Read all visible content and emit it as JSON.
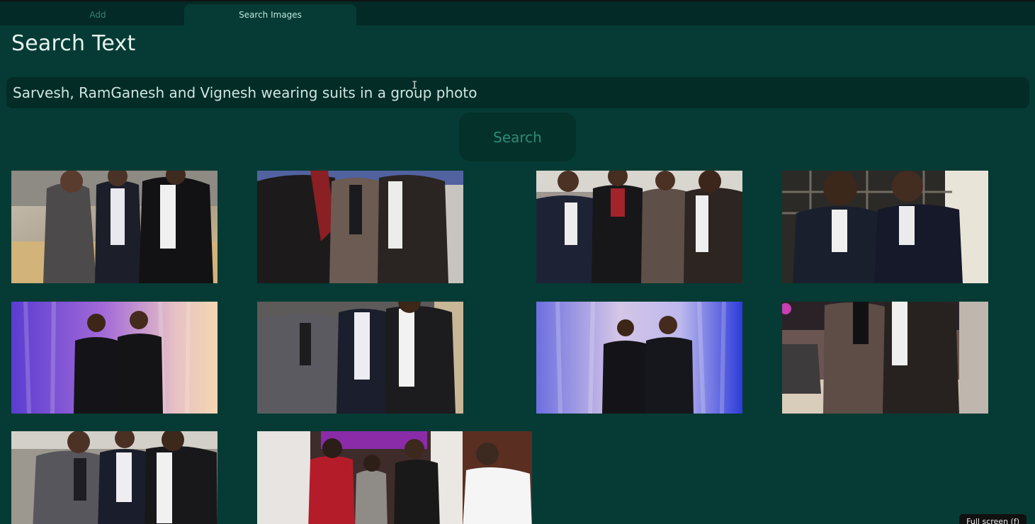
{
  "tabs": [
    {
      "label": "Add",
      "active": false
    },
    {
      "label": "Search Images",
      "active": true
    }
  ],
  "page_title": "Search Text",
  "search": {
    "value": "Sarvesh, RamGanesh and Vignesh wearing suits in a group photo",
    "button_label": "Search"
  },
  "results": [
    {
      "kind": "group-3-suits-hall"
    },
    {
      "kind": "group-3-suits-closeup"
    },
    {
      "kind": "group-4-suits"
    },
    {
      "kind": "pair-dark-suits"
    },
    {
      "kind": "pair-curtain-purple"
    },
    {
      "kind": "group-3-suits-hall-2"
    },
    {
      "kind": "pair-curtain-blue"
    },
    {
      "kind": "pair-suits-dining"
    },
    {
      "kind": "group-3-suits-hall-3"
    },
    {
      "kind": "group-4-casual"
    }
  ],
  "fullscreen_hint": "Full screen (f)",
  "colors": {
    "background": "#053b34",
    "tabbar": "#032a26",
    "input": "#032c27",
    "button": "#043129",
    "button_text": "#2f8a7a"
  }
}
